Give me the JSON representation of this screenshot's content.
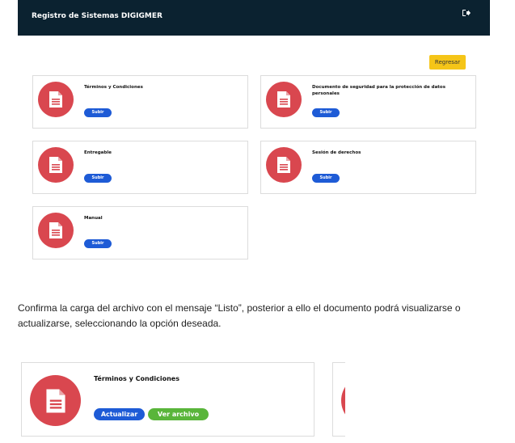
{
  "app": {
    "title": "Registro de Sistemas DIGIGMER",
    "logout_icon": "sign-out-icon",
    "back_button": "Regresar"
  },
  "cards": [
    {
      "title": "Términos y Condiciones",
      "upload_label": "Subir"
    },
    {
      "title": "Documento de seguridad para la protección de datos personales",
      "upload_label": "Subir"
    },
    {
      "title": "Entregable",
      "upload_label": "Subir"
    },
    {
      "title": "Sesión de derechos",
      "upload_label": "Subir"
    },
    {
      "title": "Manual",
      "upload_label": "Subir"
    }
  ],
  "description": "Confirma la carga del archivo con el mensaje “Listo”, posterior a ello el documento podrá visualizarse o actualizarse, seleccionando la opción deseada.",
  "detail_card": {
    "title": "Términos y Condiciones",
    "update_label": "Actualizar",
    "view_label": "Ver archivo"
  },
  "colors": {
    "navbar": "#0b2230",
    "accent_yellow": "#f5c518",
    "doc_red": "#d9474f",
    "button_blue": "#1e5bd6",
    "button_green": "#59b53a"
  }
}
